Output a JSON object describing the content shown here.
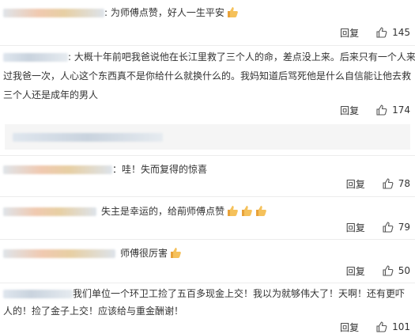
{
  "comments": [
    {
      "lines": [
        ": 为师傅点赞，好人一生平安"
      ],
      "emoji_count": 1,
      "reply_label": "回复",
      "likes": "145"
    },
    {
      "lines": [
        ": 大概十年前吧我爸说他在长江里救了三个人的命，差点没上来。后来只有一个人来看",
        "过我爸一次，人心这个东西真不是你给什么就换什么的。我妈知道后骂死他是什么自信能让他去救",
        "三个人还是成年的男人"
      ],
      "emoji_count": 0,
      "reply_label": "回复",
      "likes": "174"
    },
    {
      "lines": [
        "：哇！失而复得的惊喜"
      ],
      "emoji_count": 0,
      "reply_label": "回复",
      "likes": "78"
    },
    {
      "lines": [
        "失主是幸运的，给萷师傅点赞"
      ],
      "emoji_count": 3,
      "reply_label": "回复",
      "likes": "79"
    },
    {
      "lines": [
        "师傅很厉害"
      ],
      "emoji_count": 1,
      "reply_label": "回复",
      "likes": "50"
    },
    {
      "lines": [
        "我们单位一个环卫工捡了五百多现金上交！我以为就够伟大了！天啊！还有更吓",
        "人的！捡了金子上交！应该给与重金酬谢！"
      ],
      "emoji_count": 0,
      "reply_label": "回复",
      "likes": "101"
    }
  ],
  "icons": {
    "like": "thumbs-up-outline-icon",
    "emoji": "thumbs-up-emoji-icon"
  },
  "colors": {
    "text": "#333333",
    "separator": "#ececec",
    "emoji": "#f2b84b"
  }
}
